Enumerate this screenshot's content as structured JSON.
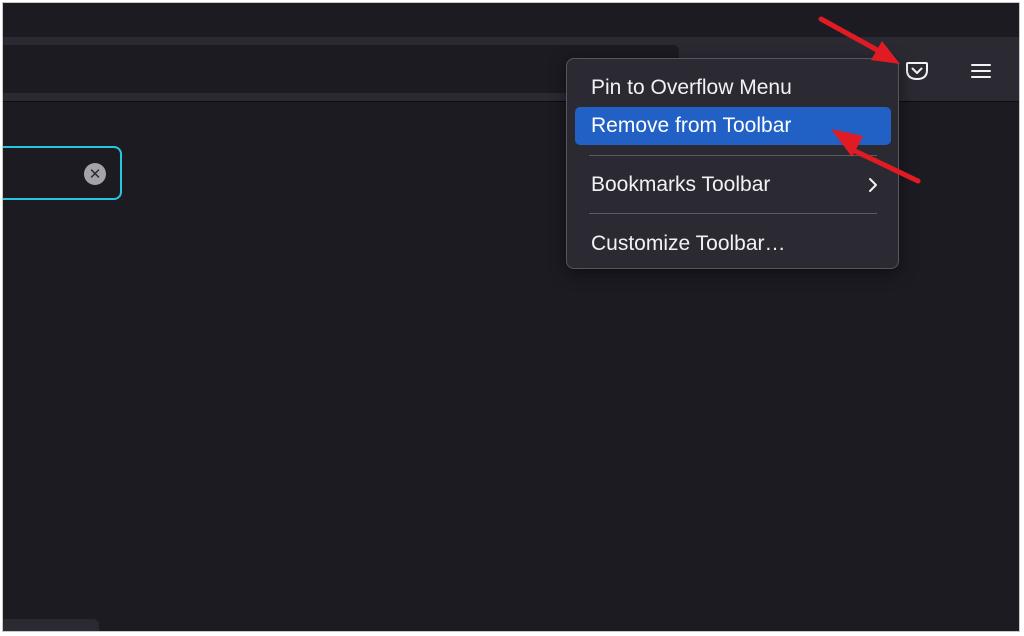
{
  "toolbar": {
    "pocket_icon": "pocket-icon",
    "menu_icon": "hamburger-menu-icon"
  },
  "search": {
    "clear_icon": "clear-icon",
    "clear_glyph": "✕"
  },
  "context_menu": {
    "items": [
      {
        "label": "Pin to Overflow Menu",
        "highlighted": false
      },
      {
        "label": "Remove from Toolbar",
        "highlighted": true
      },
      {
        "label": "Bookmarks Toolbar",
        "submenu": true
      },
      {
        "label": "Customize Toolbar…"
      }
    ]
  },
  "colors": {
    "background": "#1c1b22",
    "toolbar": "#2b2a33",
    "menu_highlight": "#2160c4",
    "focus_ring": "#28c7dd",
    "annotation_arrow": "#e01b24"
  }
}
